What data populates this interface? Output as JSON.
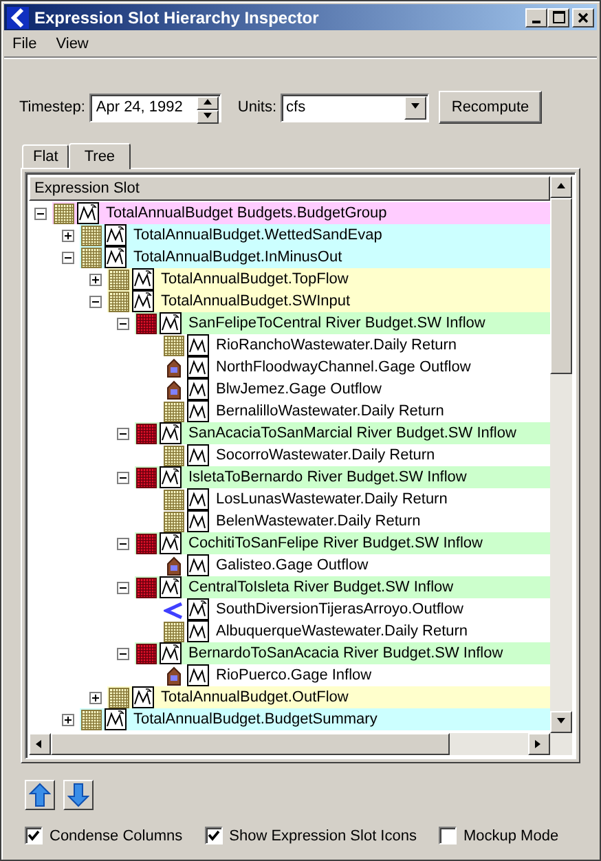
{
  "window": {
    "title": "Expression Slot Hierarchy Inspector"
  },
  "menu": [
    "File",
    "View"
  ],
  "timestep": {
    "label": "Timestep:",
    "value": "Apr 24, 1992"
  },
  "units": {
    "label": "Units:",
    "value": "cfs"
  },
  "recompute_button": "Recompute",
  "tabs": [
    {
      "label": "Flat",
      "selected": false
    },
    {
      "label": "Tree",
      "selected": true
    }
  ],
  "tree": {
    "column": "Expression Slot",
    "nodes": [
      {
        "label": "TotalAnnualBudget Budgets.BudgetGroup",
        "kind": "table",
        "expression": true,
        "expanded": true,
        "children": [
          {
            "label": "TotalAnnualBudget.WettedSandEvap",
            "kind": "table",
            "expression": true,
            "expanded": false
          },
          {
            "label": "TotalAnnualBudget.InMinusOut",
            "kind": "table",
            "expression": true,
            "expanded": true,
            "children": [
              {
                "label": "TotalAnnualBudget.TopFlow",
                "kind": "table",
                "expression": true,
                "expanded": false
              },
              {
                "label": "TotalAnnualBudget.SWInput",
                "kind": "table",
                "expression": true,
                "expanded": true,
                "children": [
                  {
                    "label": "SanFelipeToCentral River Budget.SW Inflow",
                    "kind": "budget",
                    "expression": true,
                    "expanded": true,
                    "children": [
                      {
                        "label": "RioRanchoWastewater.Daily Return",
                        "kind": "table",
                        "expression": false
                      },
                      {
                        "label": "NorthFloodwayChannel.Gage Outflow",
                        "kind": "gage",
                        "expression": false
                      },
                      {
                        "label": "BlwJemez.Gage Outflow",
                        "kind": "gage",
                        "expression": false
                      },
                      {
                        "label": "BernalilloWastewater.Daily Return",
                        "kind": "table",
                        "expression": false
                      }
                    ]
                  },
                  {
                    "label": "SanAcaciaToSanMarcial River Budget.SW Inflow",
                    "kind": "budget",
                    "expression": true,
                    "expanded": true,
                    "children": [
                      {
                        "label": "SocorroWastewater.Daily Return",
                        "kind": "table",
                        "expression": false
                      }
                    ]
                  },
                  {
                    "label": "IsletaToBernardo River Budget.SW Inflow",
                    "kind": "budget",
                    "expression": true,
                    "expanded": true,
                    "children": [
                      {
                        "label": "LosLunasWastewater.Daily Return",
                        "kind": "table",
                        "expression": false
                      },
                      {
                        "label": "BelenWastewater.Daily Return",
                        "kind": "table",
                        "expression": false
                      }
                    ]
                  },
                  {
                    "label": "CochitiToSanFelipe River Budget.SW Inflow",
                    "kind": "budget",
                    "expression": true,
                    "expanded": true,
                    "children": [
                      {
                        "label": "Galisteo.Gage Outflow",
                        "kind": "gage",
                        "expression": false
                      }
                    ]
                  },
                  {
                    "label": "CentralToIsleta River Budget.SW Inflow",
                    "kind": "budget",
                    "expression": true,
                    "expanded": true,
                    "children": [
                      {
                        "label": "SouthDiversionTijerasArroyo.Outflow",
                        "kind": "diversion",
                        "expression": true
                      },
                      {
                        "label": "AlbuquerqueWastewater.Daily Return",
                        "kind": "table",
                        "expression": false
                      }
                    ]
                  },
                  {
                    "label": "BernardoToSanAcacia River Budget.SW Inflow",
                    "kind": "budget",
                    "expression": true,
                    "expanded": true,
                    "children": [
                      {
                        "label": "RioPuerco.Gage Inflow",
                        "kind": "gage",
                        "expression": false
                      }
                    ]
                  }
                ]
              },
              {
                "label": "TotalAnnualBudget.OutFlow",
                "kind": "table",
                "expression": true,
                "expanded": false
              }
            ]
          },
          {
            "label": "TotalAnnualBudget.BudgetSummary",
            "kind": "table",
            "expression": true,
            "expanded": false
          }
        ]
      }
    ]
  },
  "checkboxes": [
    {
      "label": "Condense Columns",
      "checked": true
    },
    {
      "label": "Show Expression Slot Icons",
      "checked": true
    },
    {
      "label": "Mockup Mode",
      "checked": false
    }
  ]
}
